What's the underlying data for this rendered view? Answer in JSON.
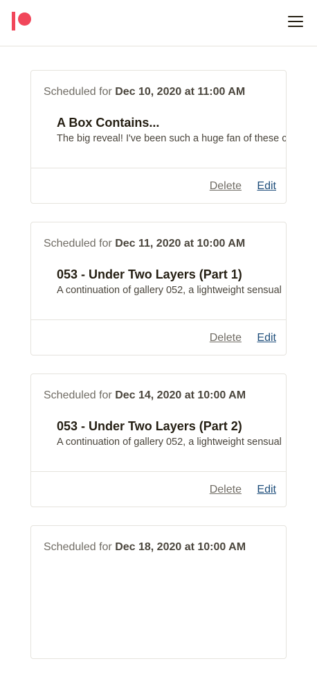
{
  "header": {
    "logo_icon": "patreon-logo",
    "menu_icon": "hamburger-menu-icon",
    "brand_color": "#f1465a"
  },
  "posts": [
    {
      "scheduled_prefix": "Scheduled for",
      "scheduled_date": "Dec 10, 2020 at 11:00 AM",
      "title": "A Box Contains...",
      "description": "The big reveal! I've been such a huge fan of these c",
      "delete_label": "Delete",
      "edit_label": "Edit"
    },
    {
      "scheduled_prefix": "Scheduled for",
      "scheduled_date": "Dec 11, 2020 at 10:00 AM",
      "title": "053 - Under Two Layers (Part 1)",
      "description": "A continuation of gallery 052, a lightweight sensual",
      "delete_label": "Delete",
      "edit_label": "Edit"
    },
    {
      "scheduled_prefix": "Scheduled for",
      "scheduled_date": "Dec 14, 2020 at 10:00 AM",
      "title": "053 - Under Two Layers (Part 2)",
      "description": "A continuation of gallery 052, a lightweight sensual",
      "delete_label": "Delete",
      "edit_label": "Edit"
    },
    {
      "scheduled_prefix": "Scheduled for",
      "scheduled_date": "Dec 18, 2020 at 10:00 AM",
      "title": "",
      "description": "",
      "delete_label": "",
      "edit_label": ""
    }
  ]
}
